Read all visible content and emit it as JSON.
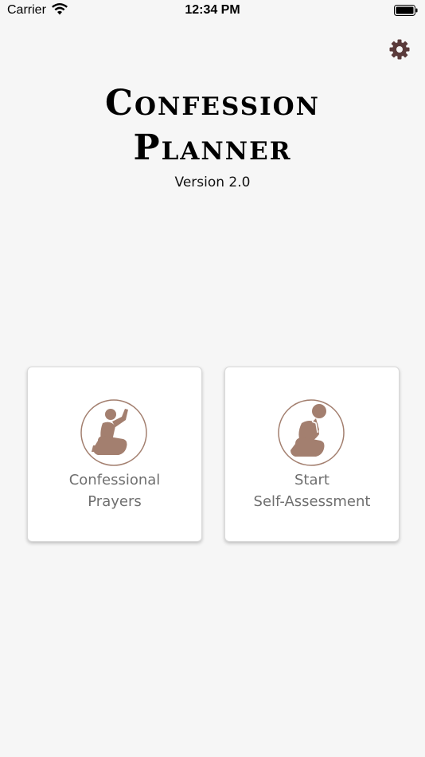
{
  "status_bar": {
    "carrier": "Carrier",
    "time": "12:34 PM"
  },
  "header": {
    "title_line1": "Confession",
    "title_line2": "Planner",
    "version": "Version 2.0"
  },
  "cards": {
    "prayers": {
      "label_line1": "Confessional",
      "label_line2": "Prayers",
      "icon": "kneeling-praying-hands-up-icon"
    },
    "assessment": {
      "label_line1": "Start",
      "label_line2": "Self-Assessment",
      "icon": "kneeling-praying-head-bowed-icon"
    }
  },
  "colors": {
    "accent": "#a37f6f",
    "gear": "#5a3a3a",
    "background": "#f6f6f6",
    "card_label": "#6f6f6f"
  }
}
